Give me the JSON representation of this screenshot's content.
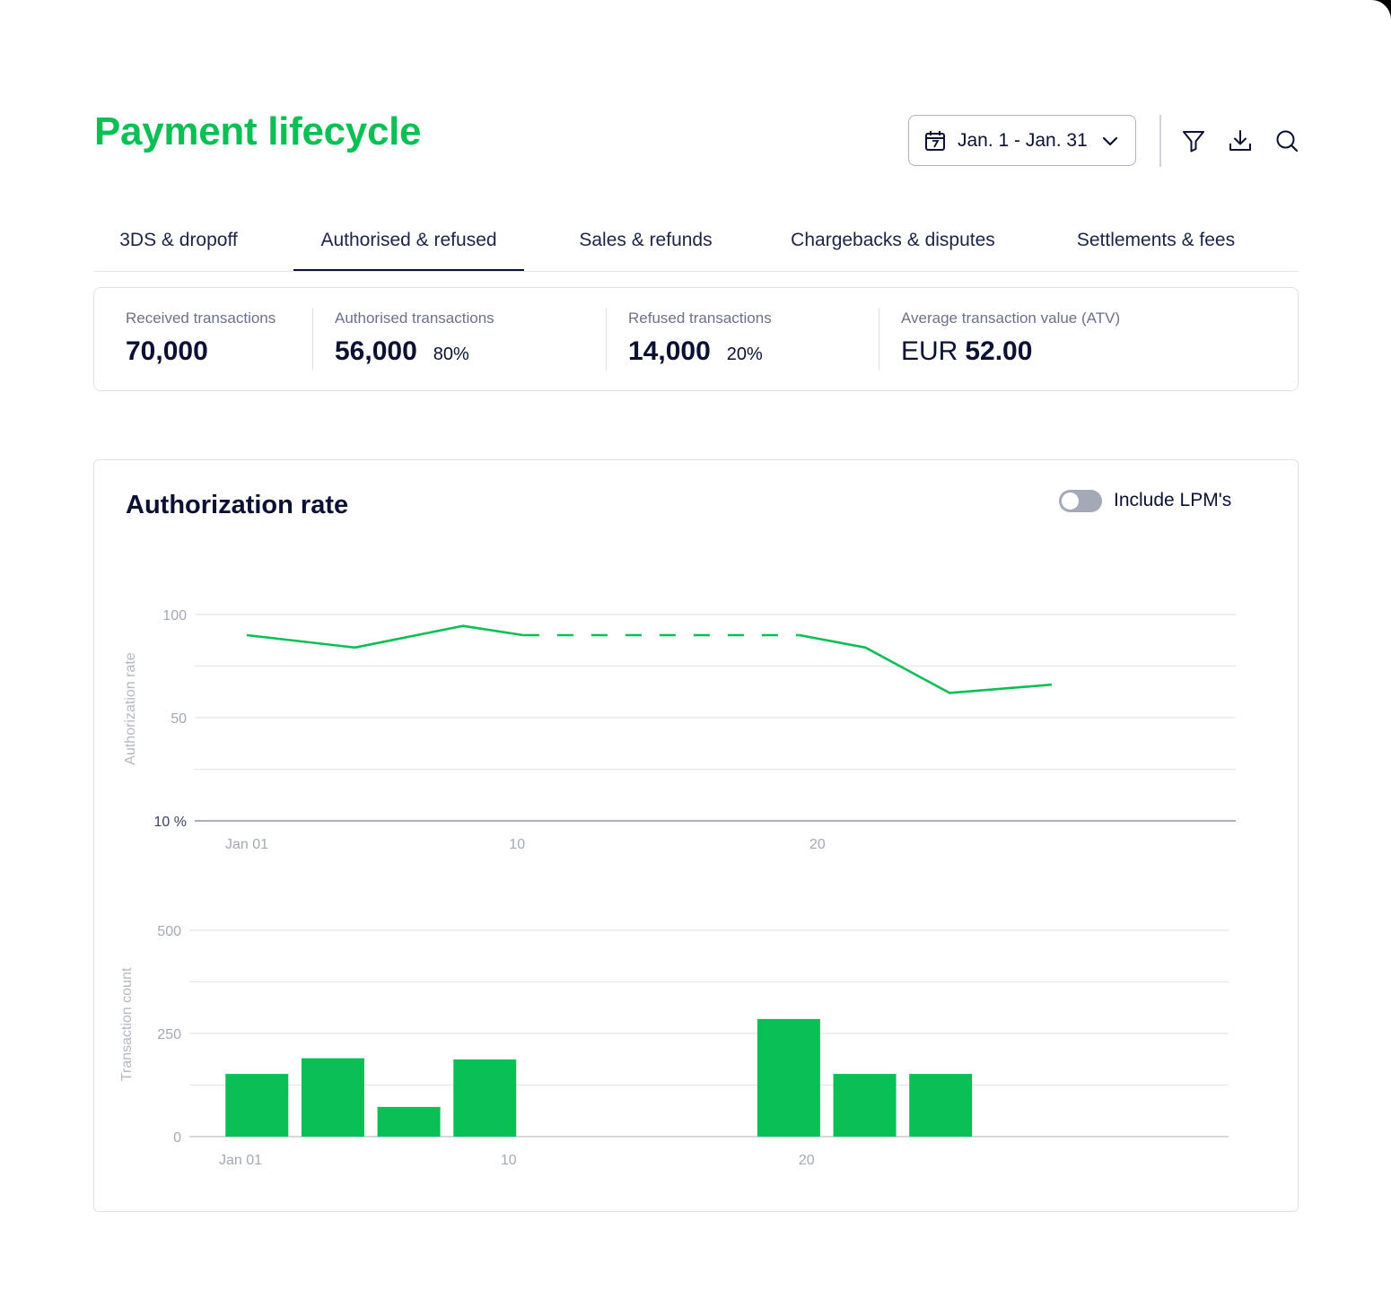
{
  "header": {
    "title": "Payment lifecycle",
    "date_range": "Jan. 1 - Jan. 31",
    "icons": {
      "calendar": "calendar-icon",
      "dropdown": "chevron-down-icon",
      "filter": "filter-icon",
      "download": "download-icon",
      "search": "search-icon"
    }
  },
  "tabs": [
    {
      "label": "3DS & dropoff",
      "active": false
    },
    {
      "label": "Authorised  & refused",
      "active": true
    },
    {
      "label": "Sales & refunds",
      "active": false
    },
    {
      "label": "Chargebacks & disputes",
      "active": false
    },
    {
      "label": "Settlements & fees",
      "active": false
    }
  ],
  "kpis": {
    "received": {
      "label": "Received transactions",
      "value": "70,000"
    },
    "authorised": {
      "label": "Authorised transactions",
      "value": "56,000",
      "pct": "80%"
    },
    "refused": {
      "label": "Refused transactions",
      "value": "14,000",
      "pct": "20%"
    },
    "atv": {
      "label": "Average transaction value (ATV)",
      "currency": "EUR",
      "value": "52.00"
    }
  },
  "chart_panel": {
    "title": "Authorization rate",
    "toggle": {
      "label": "Include LPM's",
      "on": false
    }
  },
  "colors": {
    "accent": "#0abf53",
    "text": "#0a1133",
    "muted": "#6b7288"
  },
  "chart_data": [
    {
      "type": "line",
      "ylabel": "Authorization rate",
      "yticks": [
        {
          "v": 100,
          "label": "100"
        },
        {
          "v": 50,
          "label": "50"
        },
        {
          "v": 0,
          "label": "10 %"
        }
      ],
      "ylim": [
        0,
        100
      ],
      "xlim": [
        1,
        31
      ],
      "xticks": [
        {
          "v": 1,
          "label": "Jan 01"
        },
        {
          "v": 10,
          "label": "10"
        },
        {
          "v": 20,
          "label": "20"
        }
      ],
      "grid": true,
      "series": [
        {
          "style": "solid",
          "points": [
            [
              1,
              90
            ],
            [
              4.6,
              84
            ],
            [
              8.2,
              94.5
            ],
            [
              10.2,
              90
            ]
          ]
        },
        {
          "style": "dashed",
          "points": [
            [
              10.2,
              90
            ],
            [
              19.4,
              90
            ]
          ]
        },
        {
          "style": "solid",
          "points": [
            [
              19.4,
              90
            ],
            [
              21.6,
              84
            ],
            [
              24.4,
              62
            ],
            [
              27.8,
              66
            ]
          ]
        }
      ]
    },
    {
      "type": "bar",
      "ylabel": "Transaction count",
      "yticks": [
        {
          "v": 500,
          "label": "500"
        },
        {
          "v": 250,
          "label": "250"
        },
        {
          "v": 0,
          "label": "0"
        }
      ],
      "ylim": [
        0,
        500
      ],
      "xlim": [
        1,
        31
      ],
      "xticks": [
        {
          "v": 1,
          "label": "Jan 01"
        },
        {
          "v": 10,
          "label": "10"
        },
        {
          "v": 20,
          "label": "20"
        }
      ],
      "grid": true,
      "bars": [
        {
          "x": 1.55,
          "value": 152
        },
        {
          "x": 4.1,
          "value": 190
        },
        {
          "x": 6.65,
          "value": 72
        },
        {
          "x": 9.2,
          "value": 187
        },
        {
          "x": 19.4,
          "value": 285
        },
        {
          "x": 21.95,
          "value": 152
        },
        {
          "x": 24.5,
          "value": 152
        }
      ]
    }
  ]
}
